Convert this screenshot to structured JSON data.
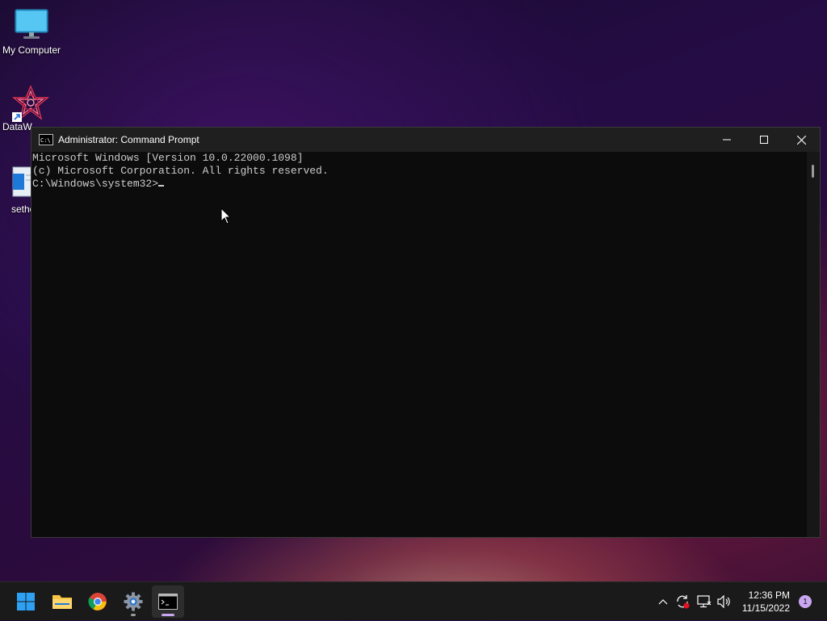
{
  "desktop": {
    "icons": [
      {
        "name": "my-computer",
        "label": "My Computer"
      },
      {
        "name": "dataw",
        "label": "DataW"
      },
      {
        "name": "setho",
        "label": "setho"
      }
    ]
  },
  "window": {
    "title": "Administrator: Command Prompt",
    "controls": {
      "minimize": "—",
      "maximize": "☐",
      "close": "✕"
    },
    "console_lines": [
      "Microsoft Windows [Version 10.0.22000.1098]",
      "(c) Microsoft Corporation. All rights reserved.",
      "C:\\Windows\\system32>"
    ]
  },
  "taskbar": {
    "items": [
      {
        "name": "start",
        "icon": "windows-logo-icon"
      },
      {
        "name": "file-explorer",
        "icon": "folder-icon"
      },
      {
        "name": "chrome",
        "icon": "chrome-icon"
      },
      {
        "name": "settings",
        "icon": "gear-icon"
      },
      {
        "name": "command-prompt",
        "icon": "terminal-icon"
      }
    ],
    "tray": {
      "chevron": "^",
      "time": "12:36 PM",
      "date": "11/15/2022",
      "notification_count": "1"
    }
  },
  "colors": {
    "accent": "#c9a7f0",
    "console_bg": "#0c0c0c",
    "console_text": "#cccccc",
    "taskbar_bg": "#1a1a1a"
  }
}
